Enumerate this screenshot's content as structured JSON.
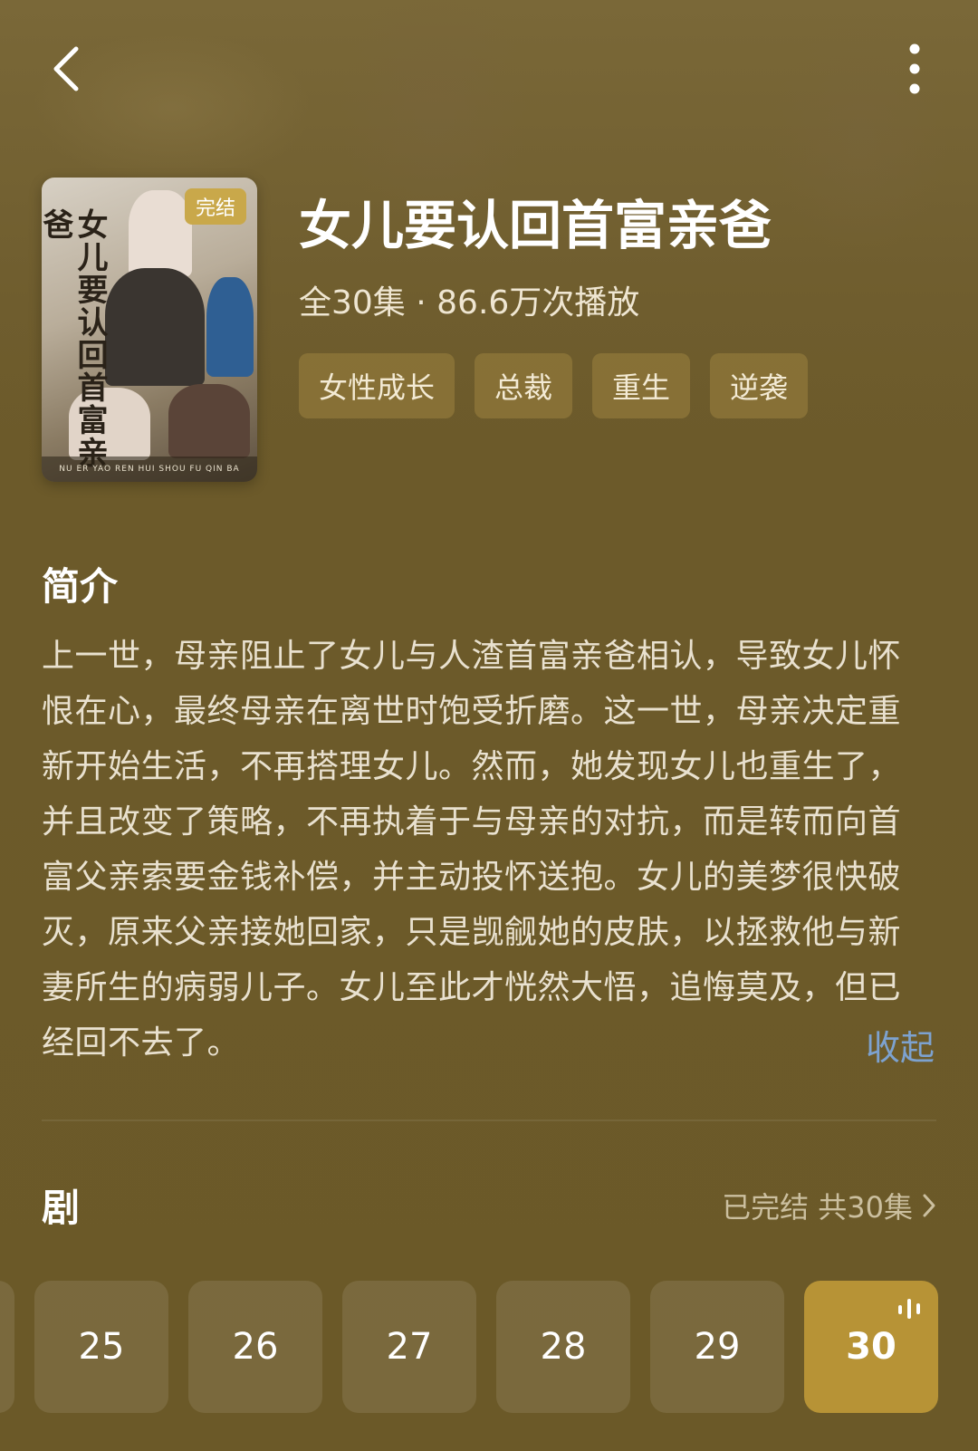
{
  "header": {
    "back_icon": "chevron-left-icon",
    "more_icon": "more-vertical-icon"
  },
  "poster": {
    "title": "女儿要认回首富亲爸",
    "badge": "完结",
    "subtitle": "NU ER YAO REN HUI SHOU FU QIN BA"
  },
  "drama": {
    "title": "女儿要认回首富亲爸",
    "meta": "全30集 · 86.6万次播放",
    "tags": [
      "女性成长",
      "总裁",
      "重生",
      "逆袭"
    ]
  },
  "synopsis": {
    "heading": "简介",
    "text": "上一世，母亲阻止了女儿与人渣首富亲爸相认，导致女儿怀恨在心，最终母亲在离世时饱受折磨。这一世，母亲决定重新开始生活，不再搭理女儿。然而，她发现女儿也重生了，并且改变了策略，不再执着于与母亲的对抗，而是转而向首富父亲索要金钱补偿，并主动投怀送抱。女儿的美梦很快破灭，原来父亲接她回家，只是觊觎她的皮肤，以拯救他与新妻所生的病弱儿子。女儿至此才恍然大悟，追悔莫及，但已经回不去了。",
    "collapse_label": "收起"
  },
  "episodes": {
    "heading": "剧",
    "status": "已完结 共30集",
    "items": [
      "25",
      "26",
      "27",
      "28",
      "29",
      "30"
    ],
    "current": "30",
    "accent_color": "#b79336"
  }
}
